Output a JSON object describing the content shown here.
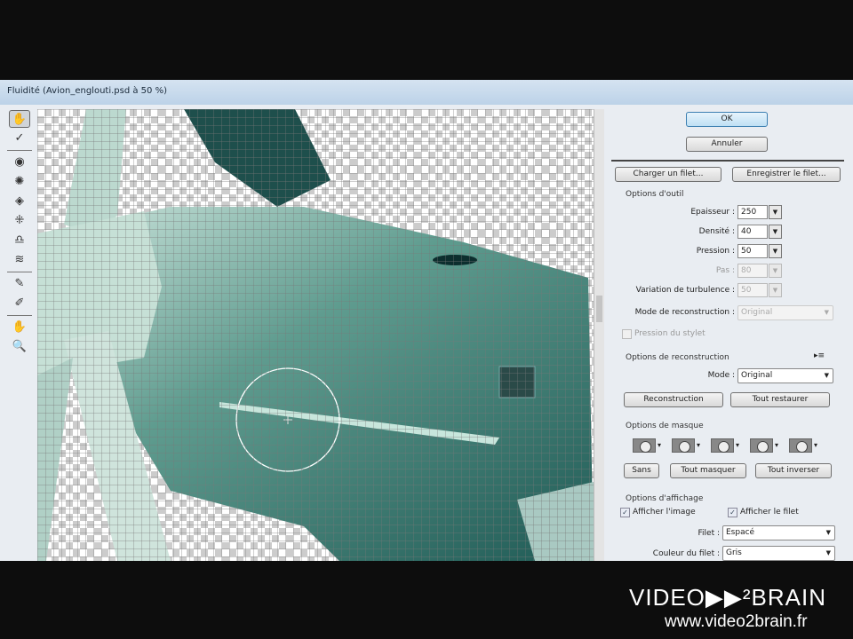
{
  "window": {
    "title": "Fluidité (Avion_englouti.psd à 50 %)"
  },
  "tools": [
    {
      "icon": "warp-tool-icon",
      "glyph": "✋"
    },
    {
      "icon": "reconstruct-tool-icon",
      "glyph": "✓"
    },
    {
      "icon": "twirl-tool-icon",
      "glyph": "◉"
    },
    {
      "icon": "pucker-tool-icon",
      "glyph": "✺"
    },
    {
      "icon": "bloat-tool-icon",
      "glyph": "◈"
    },
    {
      "icon": "push-left-tool-icon",
      "glyph": "⁜"
    },
    {
      "icon": "mirror-tool-icon",
      "glyph": "♎"
    },
    {
      "icon": "turbulence-tool-icon",
      "glyph": "≋"
    },
    {
      "icon": "freeze-mask-tool-icon",
      "glyph": "✎"
    },
    {
      "icon": "thaw-mask-tool-icon",
      "glyph": "✐"
    },
    {
      "icon": "hand-tool-icon",
      "glyph": "✋"
    },
    {
      "icon": "zoom-tool-icon",
      "glyph": "🔍"
    }
  ],
  "buttons": {
    "ok": "OK",
    "cancel": "Annuler",
    "load_mesh": "Charger un filet...",
    "save_mesh": "Enregistrer le filet...",
    "reconstruct": "Reconstruction",
    "restore_all": "Tout restaurer",
    "none": "Sans",
    "mask_all": "Tout masquer",
    "invert_all": "Tout inverser"
  },
  "tool_options": {
    "title": "Options d'outil",
    "brush_size": {
      "label": "Epaisseur :",
      "value": "250"
    },
    "density": {
      "label": "Densité :",
      "value": "40"
    },
    "pressure": {
      "label": "Pression :",
      "value": "50"
    },
    "rate": {
      "label": "Pas :",
      "value": "80"
    },
    "turbulent_jitter": {
      "label": "Variation de turbulence :",
      "value": "50"
    },
    "reconstruct_mode": {
      "label": "Mode de reconstruction :",
      "value": "Original"
    },
    "stylus_pressure": {
      "label": "Pression du stylet",
      "checked": false
    }
  },
  "reconstruct_options": {
    "title": "Options de reconstruction",
    "mode": {
      "label": "Mode :",
      "value": "Original"
    }
  },
  "mask_options": {
    "title": "Options de masque"
  },
  "view_options": {
    "title": "Options d'affichage",
    "show_image": {
      "label": "Afficher l'image",
      "checked": true
    },
    "show_mesh": {
      "label": "Afficher le filet",
      "checked": true
    },
    "mesh": {
      "label": "Filet :",
      "value": "Espacé"
    },
    "mesh_color": {
      "label": "Couleur du filet :",
      "value": "Gris"
    }
  },
  "watermark": {
    "logo": "VIDEO▶▶²BRAIN",
    "url": "www.video2brain.fr"
  }
}
